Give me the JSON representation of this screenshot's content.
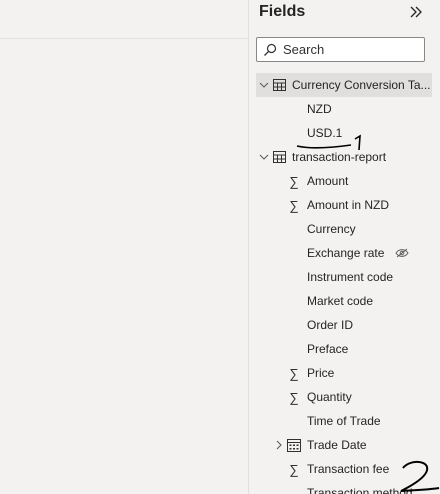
{
  "fields_pane": {
    "title": "Fields",
    "search_placeholder": "Search",
    "tables": [
      {
        "name": "Currency Conversion Ta...",
        "expanded": true,
        "selected": true,
        "fields": [
          {
            "label": "NZD",
            "aggregate": false
          },
          {
            "label": "USD.1",
            "aggregate": false
          }
        ]
      },
      {
        "name": "transaction-report",
        "expanded": true,
        "selected": false,
        "fields": [
          {
            "label": "Amount",
            "aggregate": true
          },
          {
            "label": "Amount in NZD",
            "aggregate": true
          },
          {
            "label": "Currency",
            "aggregate": false
          },
          {
            "label": "Exchange rate",
            "aggregate": false,
            "hidden": true
          },
          {
            "label": "Instrument code",
            "aggregate": false
          },
          {
            "label": "Market code",
            "aggregate": false
          },
          {
            "label": "Order ID",
            "aggregate": false
          },
          {
            "label": "Preface",
            "aggregate": false
          },
          {
            "label": "Price",
            "aggregate": true
          },
          {
            "label": "Quantity",
            "aggregate": true
          },
          {
            "label": "Time of Trade",
            "aggregate": false
          },
          {
            "label": "Trade Date",
            "aggregate": false,
            "date_hierarchy": true,
            "collapsed": true
          },
          {
            "label": "Transaction fee",
            "aggregate": true
          },
          {
            "label": "Transaction method",
            "aggregate": false
          }
        ]
      }
    ]
  },
  "annotations": [
    "1",
    "2"
  ],
  "colors": {
    "pane_bg": "#f3f2f1",
    "selected_bg": "#e1dfdd",
    "text": "#252423",
    "ink": "#000000"
  }
}
